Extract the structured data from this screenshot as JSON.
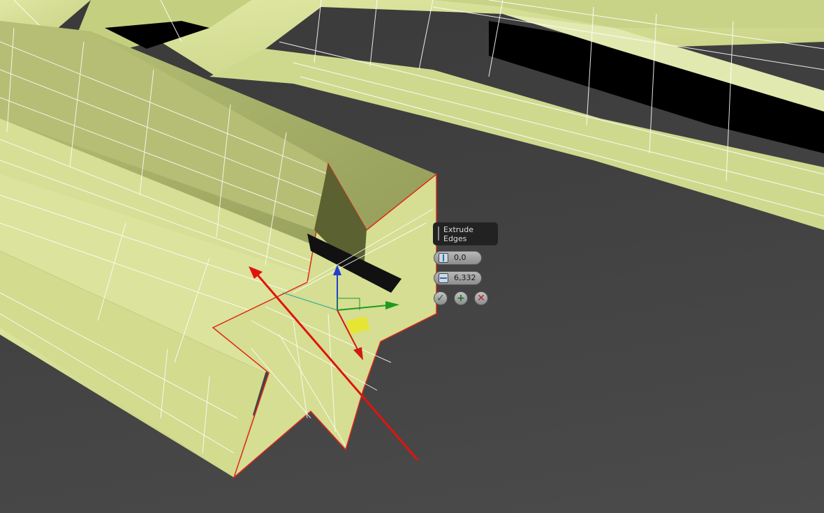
{
  "caddy": {
    "title": "Extrude Edges",
    "height": {
      "icon": "extrude-height-icon",
      "value": "0,0"
    },
    "width": {
      "icon": "extrude-base-width-icon",
      "value": "6,332"
    },
    "buttons": {
      "ok": {
        "icon": "checkmark-icon",
        "glyph": "✓"
      },
      "apply_continue": {
        "icon": "plus-icon",
        "glyph": "+"
      },
      "cancel": {
        "icon": "close-icon",
        "glyph": "✕"
      }
    }
  },
  "colors": {
    "mesh_face": "#d3dd8f",
    "mesh_face_shadow": "#9aa45c",
    "wire": "#ffffff",
    "selection": "#e0261a",
    "background": "#454545",
    "gizmo_x": "#cf1a12",
    "gizmo_y": "#1f9a1f",
    "gizmo_z": "#1f3fd2",
    "gizmo_plane": "#e8e62a"
  }
}
